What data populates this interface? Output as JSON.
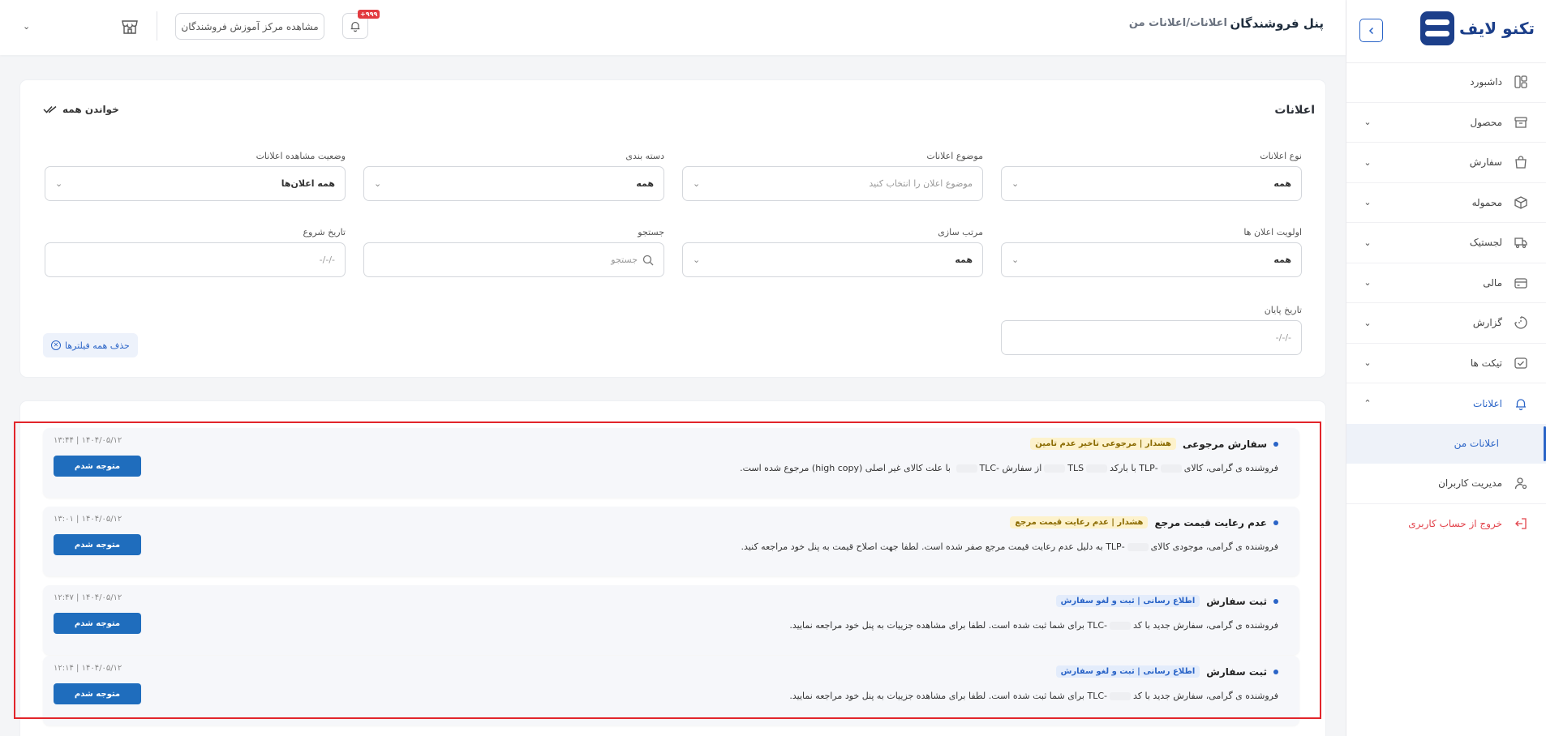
{
  "sidebar": {
    "logo_text": "تکنو لایف",
    "items": [
      {
        "label": "داشبورد",
        "icon": "dashboard-icon",
        "has_chevron": false
      },
      {
        "label": "محصول",
        "icon": "box-icon",
        "has_chevron": true
      },
      {
        "label": "سفارش",
        "icon": "shopping-bag-icon",
        "has_chevron": true
      },
      {
        "label": "محموله",
        "icon": "package-icon",
        "has_chevron": true
      },
      {
        "label": "لجستیک",
        "icon": "truck-icon",
        "has_chevron": true
      },
      {
        "label": "مالی",
        "icon": "wallet-icon",
        "has_chevron": true
      },
      {
        "label": "گزارش",
        "icon": "report-icon",
        "has_chevron": true
      },
      {
        "label": "تیکت ها",
        "icon": "ticket-icon",
        "has_chevron": true
      },
      {
        "label": "اعلانات",
        "icon": "bell-icon",
        "has_chevron": true,
        "expanded": true
      }
    ],
    "sub_item": "اعلانات من",
    "user_mgmt": "مدیریت کاربران",
    "logout": "خروج از حساب کاربری"
  },
  "header": {
    "title": "پنل فروشندگان",
    "breadcrumb": "اعلانات/اعلانات من",
    "badge": "+۹۹۹",
    "training_label": "مشاهده مرکز آموزش فروشندگان"
  },
  "filters": {
    "title": "اعلانات",
    "read_all": "خواندن همه",
    "type_label": "نوع اعلانات",
    "type_value": "همه",
    "subject_label": "موضوع اعلانات",
    "subject_placeholder": "موضوع اعلان را انتخاب کنید",
    "category_label": "دسته بندی",
    "category_value": "همه",
    "view_status_label": "وضعیت مشاهده اعلانات",
    "view_status_value": "همه اعلان‌ها",
    "priority_label": "اولویت اعلان ها",
    "priority_value": "همه",
    "sort_label": "مرتب سازی",
    "sort_value": "همه",
    "search_label": "جستجو",
    "search_placeholder": "جستجو",
    "start_date_label": "تاریخ شروع",
    "start_date_placeholder": "-/-/-",
    "end_date_label": "تاریخ پایان",
    "end_date_placeholder": "-/-/-",
    "clear_all": "حذف همه فیلترها"
  },
  "notifications": [
    {
      "title": "سفارش مرجوعی",
      "tag": "هشدار | مرجوعی تاخیر عدم تامین",
      "tag_type": "warn",
      "body_parts": [
        "فروشنده ی گرامی، کالای",
        "-TLP با بارکد",
        "TLS",
        "از سفارش",
        "-TLC",
        "با علت کالای غیر اصلی (high copy) مرجوع شده است."
      ],
      "date": "۱۴۰۴/۰۵/۱۲ | ۱۳:۴۴",
      "button": "متوجه شدم"
    },
    {
      "title": "عدم رعایت قیمت مرجع",
      "tag": "هشدار | عدم رعایت قیمت مرجع",
      "tag_type": "warn",
      "body_parts": [
        "فروشنده ی گرامی، موجودی کالای",
        "-TLP",
        "به دلیل عدم رعایت قیمت مرجع صفر شده است. لطفا جهت اصلاح قیمت به پنل خود مراجعه کنید."
      ],
      "date": "۱۴۰۴/۰۵/۱۲ | ۱۳:۰۱",
      "button": "متوجه شدم"
    },
    {
      "title": "ثبت سفارش",
      "tag": "اطلاع رسانی | ثبت و لغو سفارش",
      "tag_type": "info",
      "body_parts": [
        "فروشنده ی گرامی، سفارش جدید با کد",
        "-TLC",
        "برای شما ثبت شده است. لطفا برای مشاهده جزییات به پنل خود مراجعه نمایید."
      ],
      "date": "۱۴۰۴/۰۵/۱۲ | ۱۲:۴۷",
      "button": "متوجه شدم"
    },
    {
      "title": "ثبت سفارش",
      "tag": "اطلاع رسانی | ثبت و لغو سفارش",
      "tag_type": "info",
      "body_parts": [
        "فروشنده ی گرامی، سفارش جدید با کد",
        "-TLC",
        "برای شما ثبت شده است. لطفا برای مشاهده جزییات به پنل خود مراجعه نمایید."
      ],
      "date": "۱۴۰۴/۰۵/۱۲ | ۱۲:۱۴",
      "button": "متوجه شدم"
    }
  ]
}
